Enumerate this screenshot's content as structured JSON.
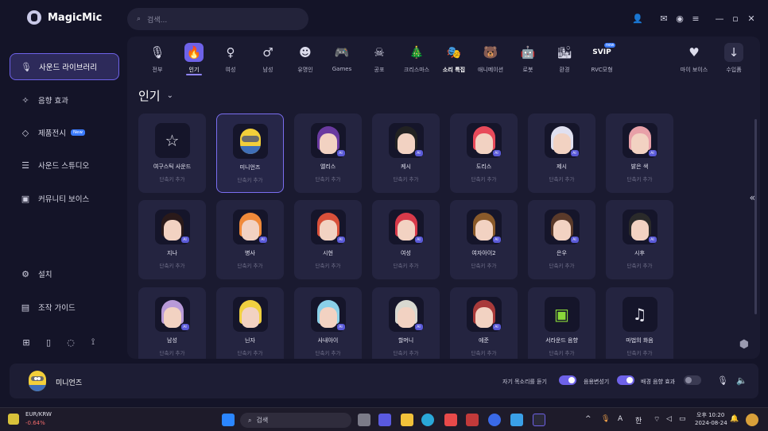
{
  "app": {
    "name": "MagicMic"
  },
  "search": {
    "placeholder": "검색..."
  },
  "sidebar": {
    "items": [
      {
        "label": "사운드 라이브러리",
        "icon": "microphone-icon"
      },
      {
        "label": "음향 효과",
        "icon": "sparkle-icon"
      },
      {
        "label": "제품전시",
        "icon": "diamond-icon",
        "badge": "New"
      },
      {
        "label": "사운드 스튜디오",
        "icon": "sliders-icon"
      },
      {
        "label": "커뮤니티 보이스",
        "icon": "community-icon"
      },
      {
        "label": "설치",
        "icon": "settings-icon"
      },
      {
        "label": "조작 가이드",
        "icon": "guide-icon"
      }
    ]
  },
  "categories": [
    {
      "label": "전부"
    },
    {
      "label": "인기"
    },
    {
      "label": "여성"
    },
    {
      "label": "남성"
    },
    {
      "label": "유명인"
    },
    {
      "label": "Games"
    },
    {
      "label": "공포"
    },
    {
      "label": "크리스마스"
    },
    {
      "label": "소리 특집"
    },
    {
      "label": "애니메이션"
    },
    {
      "label": "로봇"
    },
    {
      "label": "환경"
    },
    {
      "label": "RVC모형",
      "vip": "SVIP",
      "badge": "new"
    }
  ],
  "right_categories": [
    {
      "label": "마이 보이스"
    },
    {
      "label": "수입품"
    }
  ],
  "section": {
    "title": "인기"
  },
  "voices": [
    {
      "name": "여구스틱 사운드",
      "sub": "단축키 추가"
    },
    {
      "name": "미니언즈",
      "sub": "단축키 추가"
    },
    {
      "name": "앨리스",
      "sub": "단축키 추가"
    },
    {
      "name": "케시",
      "sub": "단축키 추가"
    },
    {
      "name": "도리스",
      "sub": "단축키 추가"
    },
    {
      "name": "제시",
      "sub": "단축키 추가"
    },
    {
      "name": "밝은 색",
      "sub": "단축키 추가"
    },
    {
      "name": "지나",
      "sub": "단축키 추가"
    },
    {
      "name": "병사",
      "sub": "단축키 추가"
    },
    {
      "name": "시현",
      "sub": "단축키 추가"
    },
    {
      "name": "여성",
      "sub": "단축키 추가"
    },
    {
      "name": "여자아이2",
      "sub": "단축키 추가"
    },
    {
      "name": "은우",
      "sub": "단축키 추가"
    },
    {
      "name": "시후",
      "sub": "단축키 추가"
    },
    {
      "name": "남성",
      "sub": "단축키 추가"
    },
    {
      "name": "닌자",
      "sub": "단축키 추가"
    },
    {
      "name": "사내아이",
      "sub": "단축키 추가"
    },
    {
      "name": "할머니",
      "sub": "단축키 추가"
    },
    {
      "name": "에준",
      "sub": "단축키 추가"
    },
    {
      "name": "서라운드 음향",
      "sub": "단축키 추가"
    },
    {
      "name": "마법의 화음",
      "sub": "단축키 추가"
    }
  ],
  "player": {
    "current": "미니언즈",
    "toggle1": "자기 목소리를 듣기",
    "toggle2": "음용변성기",
    "toggle3": "배경 음향 효과"
  },
  "taskbar": {
    "stock_name": "EUR/KRW",
    "stock_change": "-0.64%",
    "search": "검색",
    "lang": "한",
    "ime": "A",
    "time": "오후 10:20",
    "date": "2024-08-24"
  },
  "colors": {
    "accent": "#6e62e8",
    "background": "#141428",
    "panel": "#1a1a30"
  }
}
